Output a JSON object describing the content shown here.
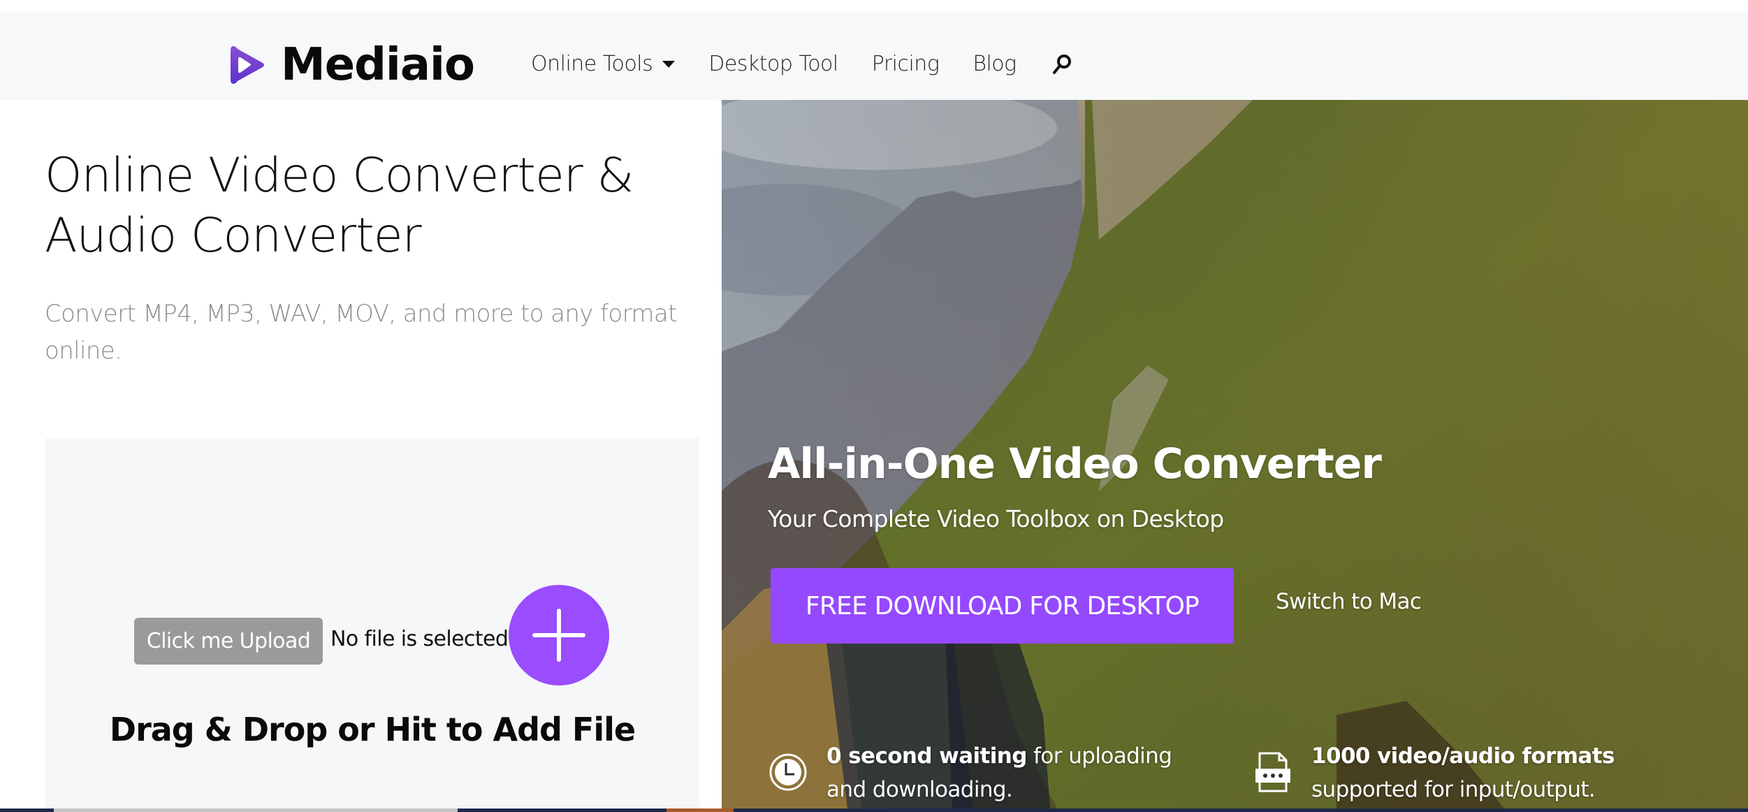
{
  "brand": {
    "name": "Mediaio",
    "accent_color": "#9549ff",
    "logo_gradient": [
      "#8a4fd6",
      "#5a34c9"
    ]
  },
  "nav": {
    "items": [
      {
        "label": "Online Tools",
        "has_dropdown": true
      },
      {
        "label": "Desktop Tool",
        "has_dropdown": false
      },
      {
        "label": "Pricing",
        "has_dropdown": false
      },
      {
        "label": "Blog",
        "has_dropdown": false
      }
    ],
    "search_icon": "search-icon"
  },
  "main": {
    "title": "Online Video Converter & Audio Converter",
    "subtitle": "Convert MP4, MP3, WAV, MOV, and more to any format online.",
    "upload": {
      "button_label": "Click me Upload",
      "status": "No file is selected",
      "add_icon": "plus-icon",
      "drop_label": "Drag & Drop or Hit to Add File"
    }
  },
  "hero": {
    "title": "All-in-One Video Converter",
    "subtitle": "Your Complete Video Toolbox on Desktop",
    "download_label": "FREE DOWNLOAD FOR DESKTOP",
    "switch_label": "Switch to Mac",
    "features": [
      {
        "icon": "clock-icon",
        "bold": "0 second waiting",
        "text": " for uploading and downloading."
      },
      {
        "icon": "file-format-icon",
        "bold": "1000 video/audio formats",
        "text": " supported for input/output."
      }
    ]
  }
}
